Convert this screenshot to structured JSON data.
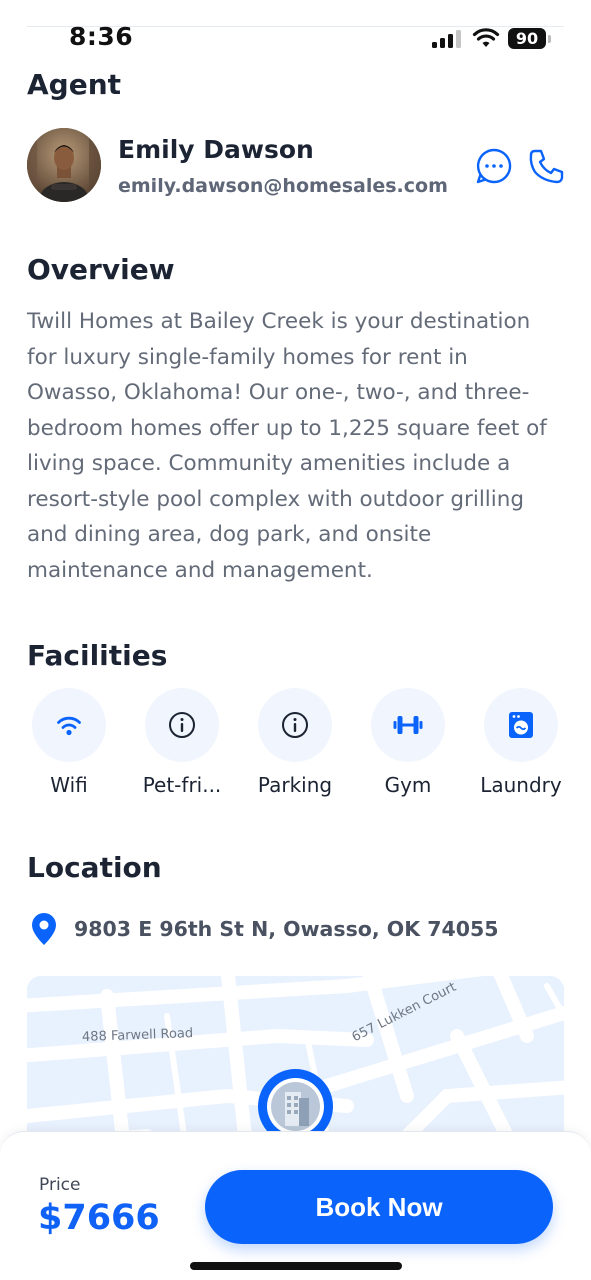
{
  "status_bar": {
    "time": "8:36",
    "battery": "90"
  },
  "agent": {
    "section_title": "Agent",
    "name": "Emily Dawson",
    "email": "emily.dawson@homesales.com"
  },
  "overview": {
    "section_title": "Overview",
    "text": "Twill Homes at Bailey Creek is your destination for luxury single-family homes for rent in Owasso, Oklahoma! Our one-, two-, and three-bedroom homes offer up to 1,225 square feet of living space. Community amenities include a resort-style pool complex with outdoor grilling and dining area, dog park, and onsite maintenance and management."
  },
  "facilities": {
    "section_title": "Facilities",
    "items": [
      {
        "label": "Wifi",
        "icon": "wifi-icon"
      },
      {
        "label": "Pet-fri...",
        "icon": "info-icon"
      },
      {
        "label": "Parking",
        "icon": "info-icon"
      },
      {
        "label": "Gym",
        "icon": "dumbbell-icon"
      },
      {
        "label": "Laundry",
        "icon": "washing-machine-icon"
      }
    ]
  },
  "location": {
    "section_title": "Location",
    "address": "9803 E 96th St N, Owasso, OK 74055",
    "map_labels": {
      "road1": "488 Farwell Road",
      "road2": "657 Lukken Court"
    }
  },
  "booking": {
    "price_label": "Price",
    "price_value": "$7666",
    "book_label": "Book Now"
  },
  "colors": {
    "accent": "#0a64fb",
    "heading": "#1c2434",
    "body_text": "#646b78",
    "facility_bg": "#f1f5fd"
  }
}
